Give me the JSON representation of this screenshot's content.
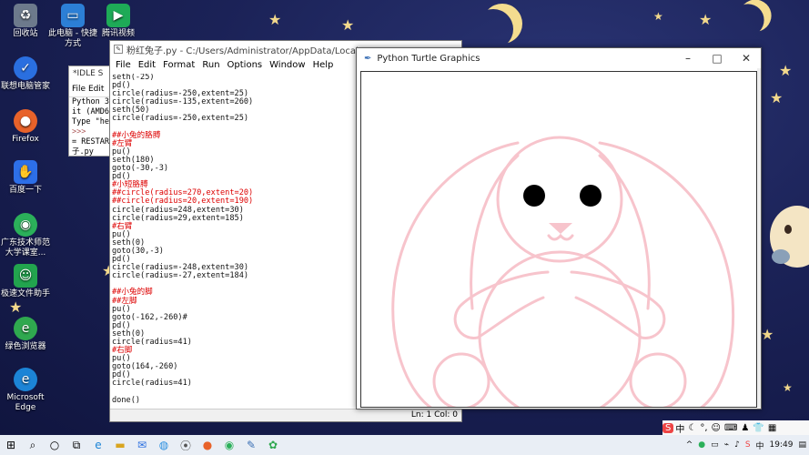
{
  "desktop_icons": [
    {
      "label": "回收站",
      "icon": "recycle-bin-icon",
      "color": "#6d7a8c"
    },
    {
      "label": "此电脑 - 快捷方式",
      "icon": "computer-icon",
      "color": "#2c7fd6"
    },
    {
      "label": "腾讯视频",
      "icon": "video-icon",
      "color": "#1eaa57"
    },
    {
      "label": "联想电脑管家",
      "icon": "lenovo-icon",
      "color": "#2a6fe0"
    },
    {
      "label": "Firefox",
      "icon": "firefox-icon",
      "color": "#e8622a"
    },
    {
      "label": "百度一下",
      "icon": "baidu-icon",
      "color": "#2d6fe8"
    },
    {
      "label": "广东技术师范大学课室...",
      "icon": "chrome-icon",
      "color": "#2bb05a"
    },
    {
      "label": "极速文件助手",
      "icon": "assistant-icon",
      "color": "#22a44e"
    },
    {
      "label": "绿色浏览器",
      "icon": "browser-icon",
      "color": "#2fa84f"
    },
    {
      "label": "Microsoft Edge",
      "icon": "edge-icon",
      "color": "#1c84d6"
    }
  ],
  "idle_shell": {
    "title": "*IDLE S",
    "menu": [
      "File",
      "Edit"
    ],
    "lines": [
      "Python 3.",
      "it (AMD64",
      "Type \"hel",
      ">>>",
      "= RESTART",
      " 子.py"
    ]
  },
  "editor": {
    "title": "粉红兔子.py - C:/Users/Administrator/AppData/Local/Programs/",
    "menu": [
      "File",
      "Edit",
      "Format",
      "Run",
      "Options",
      "Window",
      "Help"
    ],
    "code": [
      {
        "t": "seth(-25)",
        "c": false
      },
      {
        "t": "pd()",
        "c": false
      },
      {
        "t": "circle(radius=-250,extent=25)",
        "c": false
      },
      {
        "t": "circle(radius=-135,extent=260)",
        "c": false
      },
      {
        "t": "seth(50)",
        "c": false
      },
      {
        "t": "circle(radius=-250,extent=25)",
        "c": false
      },
      {
        "t": "",
        "c": false
      },
      {
        "t": "##小兔的胳膊",
        "c": true
      },
      {
        "t": "#左臂",
        "c": true
      },
      {
        "t": "pu()",
        "c": false
      },
      {
        "t": "seth(180)",
        "c": false
      },
      {
        "t": "goto(-30,-3)",
        "c": false
      },
      {
        "t": "pd()",
        "c": false
      },
      {
        "t": "#小短胳膊",
        "c": true
      },
      {
        "t": "##circle(radius=270,extent=20)",
        "c": true
      },
      {
        "t": "##circle(radius=20,extent=190)",
        "c": true
      },
      {
        "t": "circle(radius=248,extent=30)",
        "c": false
      },
      {
        "t": "circle(radius=29,extent=185)",
        "c": false
      },
      {
        "t": "#右臂",
        "c": true
      },
      {
        "t": "pu()",
        "c": false
      },
      {
        "t": "seth(0)",
        "c": false
      },
      {
        "t": "goto(30,-3)",
        "c": false
      },
      {
        "t": "pd()",
        "c": false
      },
      {
        "t": "circle(radius=-248,extent=30)",
        "c": false
      },
      {
        "t": "circle(radius=-27,extent=184)",
        "c": false
      },
      {
        "t": "",
        "c": false
      },
      {
        "t": "##小兔的脚",
        "c": true
      },
      {
        "t": "##左脚",
        "c": true
      },
      {
        "t": "pu()",
        "c": false
      },
      {
        "t": "goto(-162,-260)#",
        "c": false
      },
      {
        "t": "pd()",
        "c": false
      },
      {
        "t": "seth(0)",
        "c": false
      },
      {
        "t": "circle(radius=41)",
        "c": false
      },
      {
        "t": "#右脚",
        "c": true
      },
      {
        "t": "pu()",
        "c": false
      },
      {
        "t": "goto(164,-260)",
        "c": false
      },
      {
        "t": "pd()",
        "c": false
      },
      {
        "t": "circle(radius=41)",
        "c": false
      },
      {
        "t": "",
        "c": false
      },
      {
        "t": "done()",
        "c": false
      }
    ],
    "status": "Ln: 1  Col: 0"
  },
  "turtle": {
    "title": "Python Turtle Graphics",
    "line_color": "#f7c4cc",
    "eye_color": "#000000"
  },
  "taskbar": {
    "time": "19:49",
    "ime_label": "中"
  }
}
